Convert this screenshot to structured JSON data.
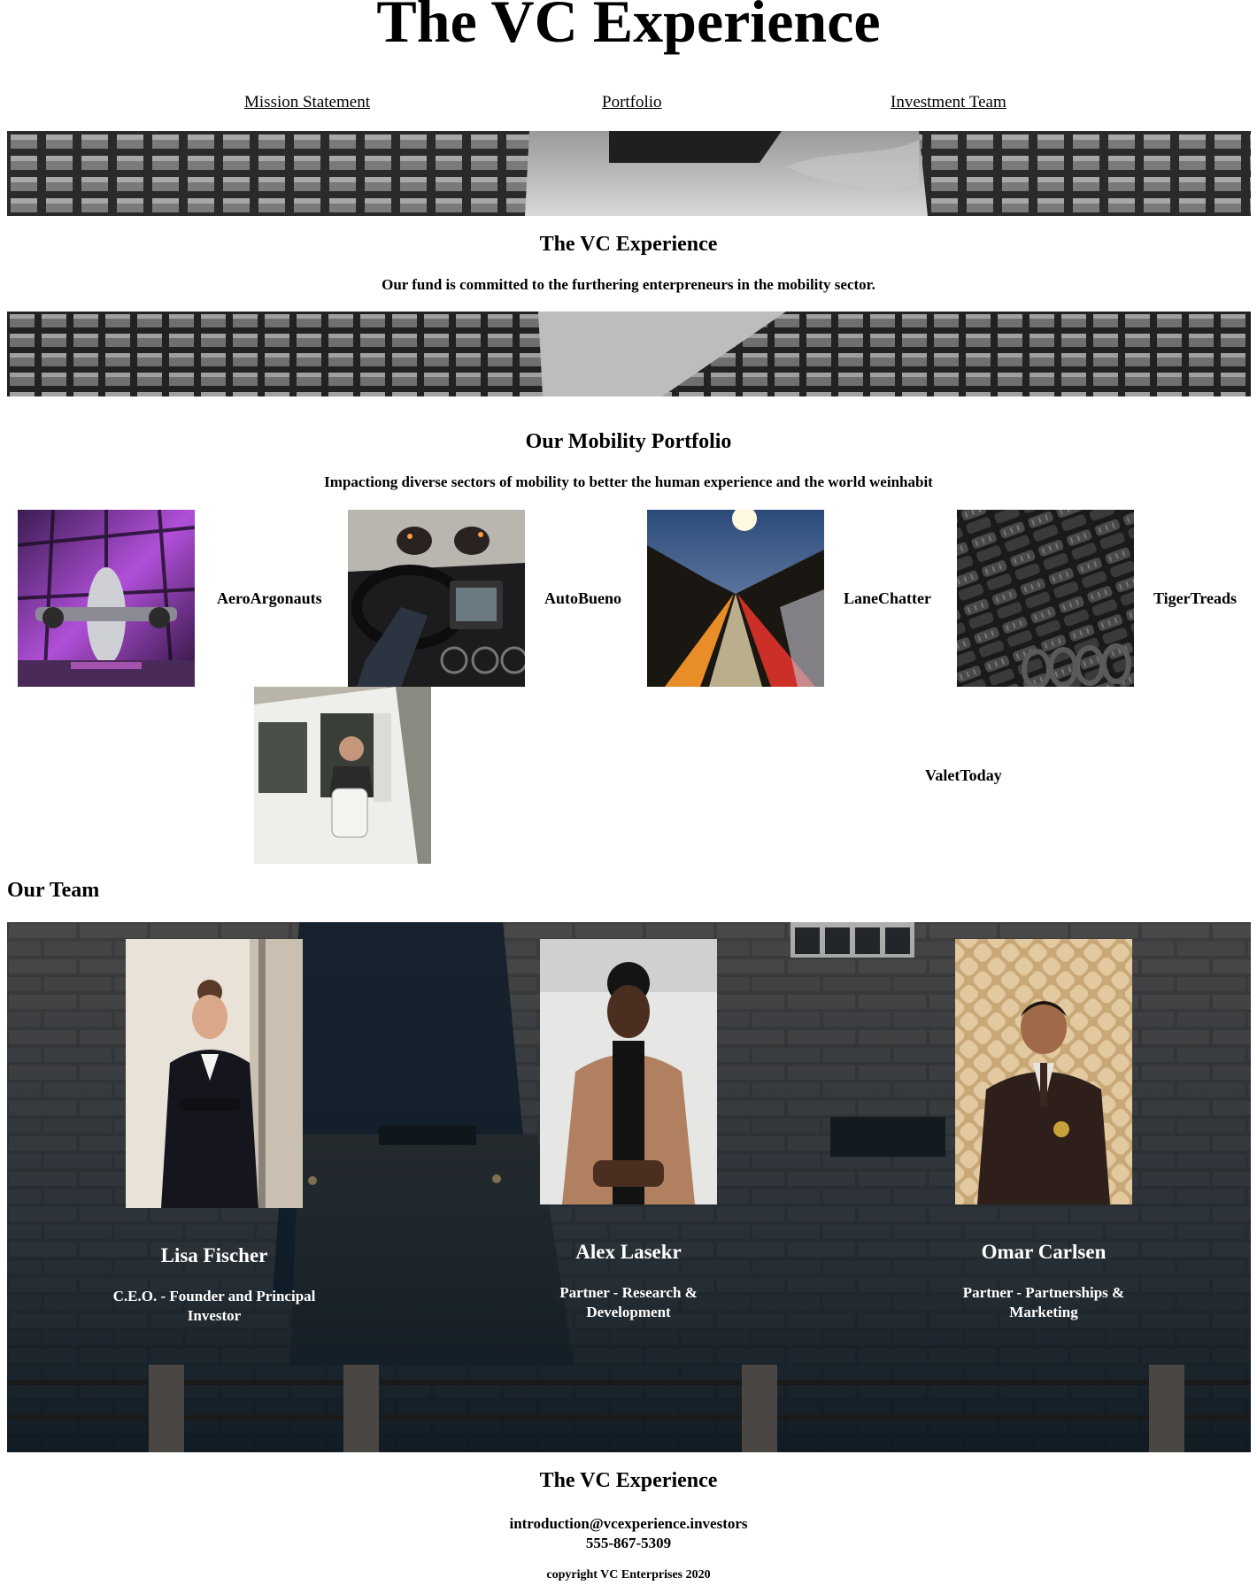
{
  "site": {
    "title": "The VC Experience"
  },
  "nav": {
    "items": [
      {
        "label": "Mission Statement"
      },
      {
        "label": "Portfolio"
      },
      {
        "label": "Investment Team"
      }
    ]
  },
  "mission": {
    "heading": "The VC Experience",
    "text": "Our fund is committed to the furthering enterpreneurs in the mobility sector."
  },
  "portfolio": {
    "heading": "Our Mobility Portfolio",
    "subheading": "Impactiong diverse sectors of mobility to better the human experience and the world weinhabit",
    "companies": [
      {
        "name": "AeroArgonauts",
        "image": "private-jet-in-purple-hangar"
      },
      {
        "name": "AutoBueno",
        "image": "car-dashboard-tunnel"
      },
      {
        "name": "LaneChatter",
        "image": "highway-light-trails"
      },
      {
        "name": "TigerTreads",
        "image": "stacked-tires"
      },
      {
        "name": "ValetToday",
        "image": "man-in-white-van"
      }
    ]
  },
  "team": {
    "heading": "Our Team",
    "members": [
      {
        "name": "Lisa Fischer",
        "role_line1": "C.E.O. - Founder and Principal",
        "role_line2": "Investor"
      },
      {
        "name": "Alex Lasekr",
        "role_line1": "Partner - Research &",
        "role_line2": "Development"
      },
      {
        "name": "Omar Carlsen",
        "role_line1": "Partner - Partnerships &",
        "role_line2": "Marketing"
      }
    ]
  },
  "footer": {
    "title": "The VC Experience",
    "email": "introduction@vcexperience.investors",
    "phone": "555-867-5309",
    "copyright": "copyright VC Enterprises 2020"
  }
}
